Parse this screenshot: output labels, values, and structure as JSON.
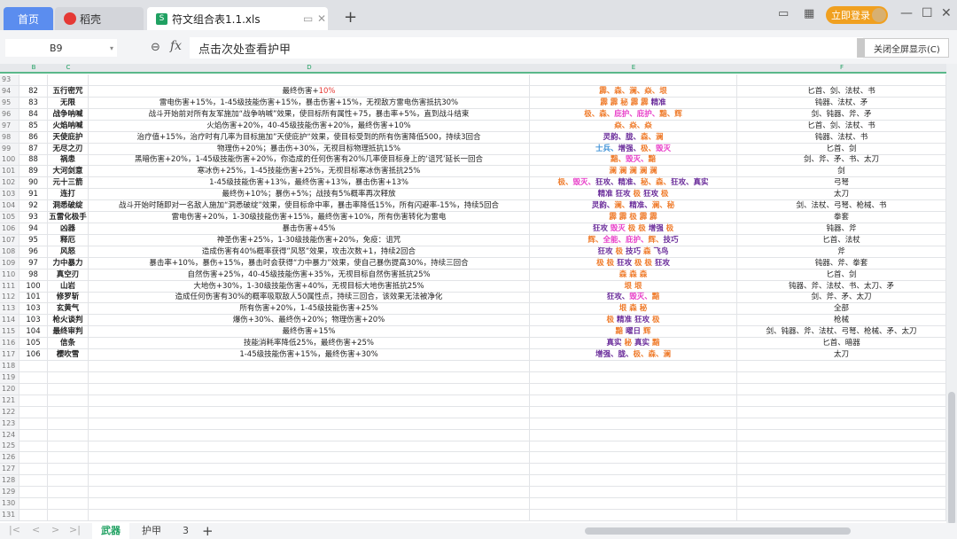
{
  "tabs": {
    "home": "首页",
    "docer": "稻壳",
    "file": "符文组合表1.1.xls",
    "new_tab": "+"
  },
  "topright": {
    "login": "立即登录"
  },
  "formula": {
    "cell_ref": "B9",
    "fx": "fx",
    "value": "点击次处查看护甲",
    "fullscreen_close": "关闭全屏显示(C)"
  },
  "columns": [
    "B",
    "C",
    "D",
    "E",
    "F"
  ],
  "colors": {
    "o": "#ef7d2e",
    "p": "#6a2c9a",
    "k": "#e83ec8",
    "b": "#3a8fd6",
    "red": "#e53935"
  },
  "rows": [
    {
      "n": "93",
      "id": "",
      "name": "",
      "desc": "",
      "desc_red": "",
      "runes": [],
      "weapons": ""
    },
    {
      "n": "94",
      "id": "82",
      "name": "五行密咒",
      "desc": "最终伤害+",
      "desc_red": "10%",
      "runes": [
        [
          "霹、森、澜、焱、垠",
          "o"
        ]
      ],
      "weapons": "匕首、剑、法杖、书"
    },
    {
      "n": "95",
      "id": "83",
      "name": "无限",
      "desc": "雷电伤害+15%，1-45级技能伤害+15%，暴击伤害+15%，无视敌方雷电伤害抵抗30%",
      "desc_red": "",
      "runes": [
        [
          "霹 霹 秘 霹 霹 ",
          "o"
        ],
        [
          "精准",
          "p"
        ]
      ],
      "weapons": "钝器、法杖、矛"
    },
    {
      "n": "96",
      "id": "84",
      "name": "战争呐喊",
      "desc": "战斗开始前对所有友军施加“战争呐喊”效果，使目标所有属性+75，暴击率+5%，直到战斗结束",
      "desc_red": "",
      "runes": [
        [
          "极、森、",
          "o"
        ],
        [
          "庇护、庇护、",
          "k"
        ],
        [
          "黯、辉",
          "o"
        ]
      ],
      "weapons": "剑、钝器、斧、矛"
    },
    {
      "n": "97",
      "id": "85",
      "name": "火焰呐喊",
      "desc": "火焰伤害+20%，40-45级技能伤害+20%，最终伤害+10%",
      "desc_red": "",
      "runes": [
        [
          "焱、焱、焱",
          "o"
        ]
      ],
      "weapons": "匕首、剑、法杖、书"
    },
    {
      "n": "98",
      "id": "86",
      "name": "天使庇护",
      "desc": "治疗值+15%，治疗时有几率为目标施加”天使庇护“效果，使目标受到的所有伤害降低500，持续3回合",
      "desc_red": "",
      "runes": [
        [
          "灵韵、胧、",
          "p"
        ],
        [
          "森、澜",
          "o"
        ]
      ],
      "weapons": "钝器、法杖、书"
    },
    {
      "n": "99",
      "id": "87",
      "name": "无尽之刃",
      "desc": "物理伤+20%；暴击伤+30%，无视目标物理抵抗15%",
      "desc_red": "",
      "runes": [
        [
          "士兵、",
          "b"
        ],
        [
          "增强、",
          "p"
        ],
        [
          "极、",
          "o"
        ],
        [
          "毁灭",
          "k"
        ]
      ],
      "weapons": "匕首、剑"
    },
    {
      "n": "100",
      "id": "88",
      "name": "祸患",
      "desc": "黑暗伤害+20%，1-45级技能伤害+20%，你造成的任何伤害有20%几率使目标身上的‘诅咒’延长一回合",
      "desc_red": "",
      "runes": [
        [
          "黯、",
          "o"
        ],
        [
          "毁灭、",
          "k"
        ],
        [
          "黯",
          "o"
        ]
      ],
      "weapons": "剑、斧、矛、书、太刀"
    },
    {
      "n": "101",
      "id": "89",
      "name": "大河剑意",
      "desc": "寒冰伤+25%，1-45技能伤害+25%，无视目标寒冰伤害抵抗25%",
      "desc_red": "",
      "runes": [
        [
          "澜 澜 澜 澜 澜",
          "o"
        ]
      ],
      "weapons": "剑"
    },
    {
      "n": "102",
      "id": "90",
      "name": "元十三箭",
      "desc": "1-45级技能伤害+13%，最终伤害+13%，暴击伤害+13%",
      "desc_red": "",
      "runes": [
        [
          "极、",
          "o"
        ],
        [
          "毁灭、",
          "k"
        ],
        [
          "狂攻、精准、",
          "p"
        ],
        [
          "秘、森、",
          "o"
        ],
        [
          "狂攻、真实",
          "p"
        ]
      ],
      "weapons": "弓弩"
    },
    {
      "n": "103",
      "id": "91",
      "name": "连打",
      "desc": "最终伤+10%；暴伤+5%；战技有5%概率再次释放",
      "desc_red": "",
      "runes": [
        [
          "精准 狂攻 ",
          "p"
        ],
        [
          "极 ",
          "o"
        ],
        [
          "狂攻 ",
          "p"
        ],
        [
          "极",
          "o"
        ]
      ],
      "weapons": "太刀"
    },
    {
      "n": "104",
      "id": "92",
      "name": "洞悉破绽",
      "desc": "战斗开始时随即对一名敌人施加“洞悉破绽”效果，使目标命中率，暴击率降低15%，所有闪避率-15%，持续5回合",
      "desc_red": "",
      "runes": [
        [
          "灵韵、",
          "p"
        ],
        [
          "澜、",
          "o"
        ],
        [
          "精准、",
          "p"
        ],
        [
          "澜、秘",
          "o"
        ]
      ],
      "weapons": "剑、法杖、弓弩、枪械、书"
    },
    {
      "n": "105",
      "id": "93",
      "name": "五雷化极手",
      "desc": "雷电伤害+20%，1-30级技能伤害+15%，最终伤害+10%，所有伤害转化为雷电",
      "desc_red": "",
      "runes": [
        [
          "霹 霹 极 霹 霹",
          "o"
        ]
      ],
      "weapons": "拳套"
    },
    {
      "n": "106",
      "id": "94",
      "name": "凶器",
      "desc": "暴击伤害+45%",
      "desc_red": "",
      "runes": [
        [
          "狂攻 ",
          "p"
        ],
        [
          "毁灭 ",
          "k"
        ],
        [
          "极 极 ",
          "o"
        ],
        [
          "增强 ",
          "p"
        ],
        [
          "极",
          "o"
        ]
      ],
      "weapons": "钝器、斧"
    },
    {
      "n": "107",
      "id": "95",
      "name": "释厄",
      "desc": "神圣伤害+25%，1-30级技能伤害+20%，免疫：诅咒",
      "desc_red": "",
      "runes": [
        [
          "辉、",
          "o"
        ],
        [
          "全能、庇护、",
          "k"
        ],
        [
          "辉、",
          "o"
        ],
        [
          "技巧",
          "p"
        ]
      ],
      "weapons": "匕首、法杖"
    },
    {
      "n": "108",
      "id": "96",
      "name": "风怒",
      "desc": "造成伤害有40%概率获得”风怒”效果，攻击次数+1，持续2回合",
      "desc_red": "",
      "runes": [
        [
          "狂攻 ",
          "p"
        ],
        [
          "极 ",
          "o"
        ],
        [
          "技巧 ",
          "p"
        ],
        [
          "森 ",
          "o"
        ],
        [
          "飞鸟",
          "p"
        ]
      ],
      "weapons": "斧"
    },
    {
      "n": "109",
      "id": "97",
      "name": "力中暴力",
      "desc": "暴击率+10%，暴伤+15%，暴击时会获得“力中暴力”效果，使自己暴伤提高30%，持续三回合",
      "desc_red": "",
      "runes": [
        [
          "极 极 ",
          "o"
        ],
        [
          "狂攻 ",
          "p"
        ],
        [
          "极 极 ",
          "o"
        ],
        [
          "狂攻",
          "p"
        ]
      ],
      "weapons": "钝器、斧、拳套"
    },
    {
      "n": "110",
      "id": "98",
      "name": "真空刃",
      "desc": "自然伤害+25%，40-45级技能伤害+35%，无视目标自然伤害抵抗25%",
      "desc_red": "",
      "runes": [
        [
          "森 森 森",
          "o"
        ]
      ],
      "weapons": "匕首、剑"
    },
    {
      "n": "111",
      "id": "100",
      "name": "山岩",
      "desc": "大地伤+30%，1-30级技能伤害+40%，无视目标大地伤害抵抗25%",
      "desc_red": "",
      "runes": [
        [
          "垠 垠",
          "o"
        ]
      ],
      "weapons": "钝器、斧、法杖、书、太刀、矛"
    },
    {
      "n": "112",
      "id": "101",
      "name": "修罗斩",
      "desc": "造成任何伤害有30%的概率吸取敌人50属性点，持续三回合，该效果无法被净化",
      "desc_red": "",
      "runes": [
        [
          "狂攻、",
          "p"
        ],
        [
          "毁灭、",
          "k"
        ],
        [
          "黯",
          "o"
        ]
      ],
      "weapons": "剑、斧、矛、太刀"
    },
    {
      "n": "113",
      "id": "103",
      "name": "玄黄气",
      "desc": "所有伤害+20%，1-45级技能伤害+25%",
      "desc_red": "",
      "runes": [
        [
          "垠 森 秘",
          "o"
        ]
      ],
      "weapons": "全部"
    },
    {
      "n": "114",
      "id": "103",
      "name": "枪火谈判",
      "desc": "爆伤+30%、最终伤+20%；物理伤害+20%",
      "desc_red": "",
      "runes": [
        [
          "极 ",
          "o"
        ],
        [
          "精准 狂攻 ",
          "p"
        ],
        [
          "极",
          "o"
        ]
      ],
      "weapons": "枪械"
    },
    {
      "n": "115",
      "id": "104",
      "name": "最终审判",
      "desc": "最终伤害+15%",
      "desc_red": "",
      "runes": [
        [
          "黯 ",
          "o"
        ],
        [
          "曜日 ",
          "p"
        ],
        [
          "辉",
          "o"
        ]
      ],
      "weapons": "剑、钝器、斧、法杖、弓弩、枪械、矛、太刀"
    },
    {
      "n": "116",
      "id": "105",
      "name": "信条",
      "desc": "技能消耗率降低25%，最终伤害+25%",
      "desc_red": "",
      "runes": [
        [
          "真实 ",
          "p"
        ],
        [
          "秘 ",
          "o"
        ],
        [
          "真实 ",
          "p"
        ],
        [
          "黯",
          "o"
        ]
      ],
      "weapons": "匕首、暗器"
    },
    {
      "n": "117",
      "id": "106",
      "name": "樱吹雪",
      "desc": "1-45级技能伤害+15%，最终伤害+30%",
      "desc_red": "",
      "runes": [
        [
          "增强、胧、",
          "p"
        ],
        [
          "极、森、澜",
          "o"
        ]
      ],
      "weapons": "太刀"
    },
    {
      "n": "118"
    },
    {
      "n": "119"
    },
    {
      "n": "120"
    },
    {
      "n": "121"
    },
    {
      "n": "122"
    },
    {
      "n": "123"
    },
    {
      "n": "124"
    },
    {
      "n": "125"
    },
    {
      "n": "126"
    },
    {
      "n": "127"
    },
    {
      "n": "128"
    },
    {
      "n": "129"
    },
    {
      "n": "130"
    },
    {
      "n": "131"
    }
  ],
  "sheets": [
    "武器",
    "护甲",
    "3"
  ],
  "add_sheet": "+"
}
